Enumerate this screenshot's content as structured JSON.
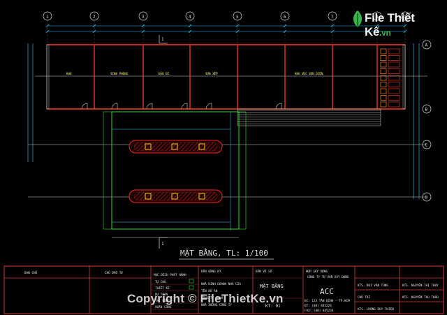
{
  "drawing": {
    "title": "MẶT BẰNG, TL: 1/100",
    "grid_cols": [
      "1",
      "2",
      "3",
      "4",
      "5",
      "6",
      "7",
      "8",
      "9"
    ],
    "grid_rows": [
      "A",
      "B",
      "C",
      "D"
    ],
    "room_labels": [
      "KHO",
      "SINH PHÒNG",
      "BẢO BÌ",
      "SƠN XẾP",
      "KHU VỰC SƠN ĐIỆN"
    ]
  },
  "title_block": {
    "c1": "BAN CHỦ",
    "c2": "CHỦ ĐẦU TƯ",
    "c3_header": "MỤC ĐÍCH PHÁT HÀNH",
    "c3_items": [
      "TỰ CHỦ",
      "THIẾT KẾ",
      "DỰ TOÁN",
      "THI CÔNG",
      "HOÀN CÔNG"
    ],
    "c4_header": "BẢN ĐĂNG KÝ",
    "c4_items": [
      "NHÀ KINH DOANH NHÀ GIA",
      "TÊN ĐỒ ÁN",
      "CÔNG TY TNHH",
      "NHÀ XƯỞNG CÔNG TY"
    ],
    "c5_header": "BẢN VẼ SỐ",
    "c5_title": "MẶT BẰNG",
    "c5_num": "KT: 01",
    "c6_header": "HỢP XÂY DỰNG",
    "c6_sub": "CÔNG TY TƯ VẤN XÂY DỰNG",
    "c6_big": "ACC",
    "c6_addr": "ĐC: 123 TÂN BÌNH - TP.HCM",
    "c6_tel": "ĐT: (08) 845226",
    "c6_fax": "FAX: (08) 845226",
    "c7_items": [
      "KTS. BÙI VĂN TÙNG",
      "CHỦ TRÌ",
      "KTS. LƯƠNG DUY THIỆN"
    ],
    "c8_items": [
      "KTS. NGUYỄN THỊ THÚY",
      "KTS. NGUYỄN THU THẢO"
    ]
  },
  "watermark": {
    "logo": "File Thiết Kế",
    "logo_suffix": ".vn",
    "copyright": "Copyright © FileThietKe.vn"
  },
  "colors": {
    "background": "#000000",
    "wall": "#ff3b1f",
    "grid": "#ffffff",
    "dimension": "#34c6ff",
    "frame": "#d63a3a",
    "fence": "#33dd33",
    "hatch": "#ff2222",
    "label": "#ffff66"
  }
}
